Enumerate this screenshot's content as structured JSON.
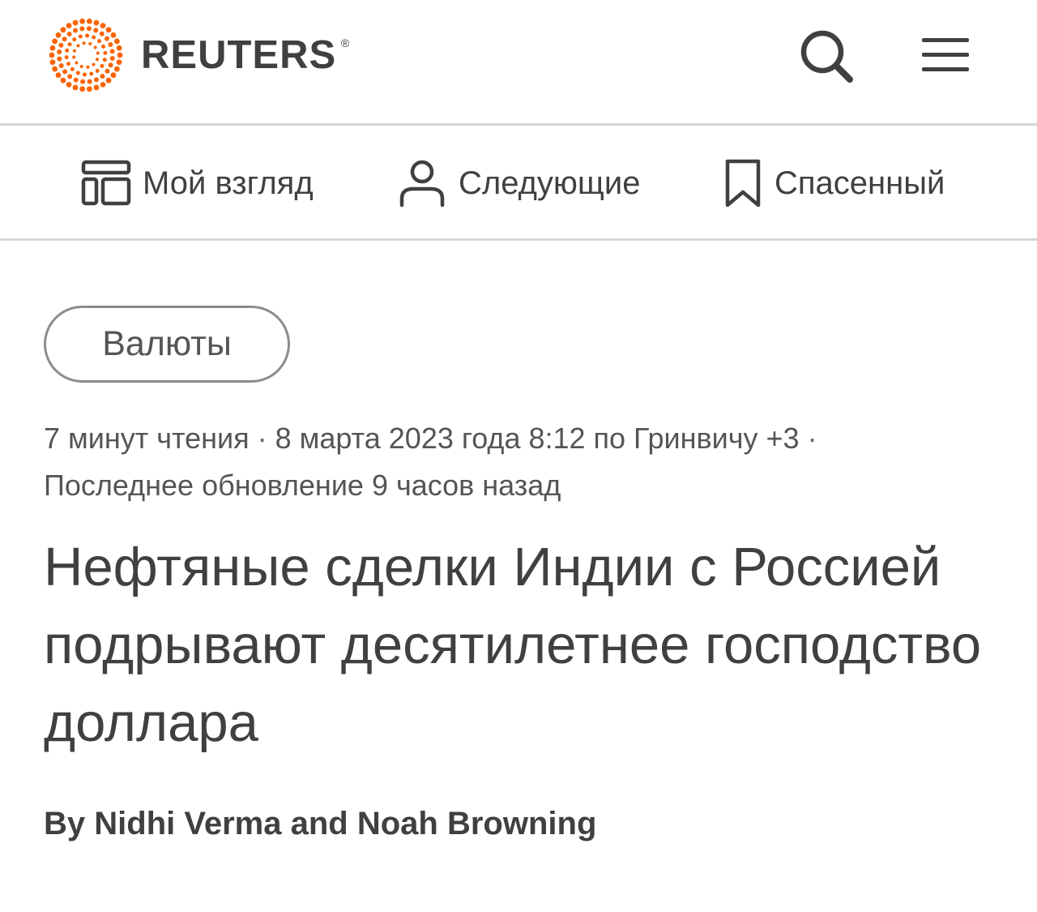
{
  "brand": {
    "name": "REUTERS",
    "registered_mark": "®",
    "logo_color": "#fa6400"
  },
  "header": {
    "search_icon": "search-icon",
    "menu_icon": "hamburger-menu-icon"
  },
  "subnav": {
    "items": [
      {
        "label": "Мой взгляд",
        "icon": "layout-grid-icon"
      },
      {
        "label": "Следующие",
        "icon": "person-icon"
      },
      {
        "label": "Спасенный",
        "icon": "bookmark-icon"
      }
    ]
  },
  "article": {
    "topic": "Валюты",
    "meta": {
      "read_time": "7 минут чтения",
      "date": "8 марта 2023 года 8:12 по Гринвичу +3",
      "separator": "·",
      "updated": "Последнее обновление 9 часов назад"
    },
    "headline": "Нефтяные сделки Индии с Россией подрывают десятилетнее господство доллара",
    "byline": {
      "prefix": "By",
      "author_1": "Nidhi Verma",
      "conjunction": "and",
      "author_2": "Noah Browning"
    }
  },
  "colors": {
    "text": "#404040",
    "muted_text": "#555555",
    "divider": "#d6d6d6",
    "pill_border": "#8c8c8c",
    "accent": "#fa6400"
  }
}
